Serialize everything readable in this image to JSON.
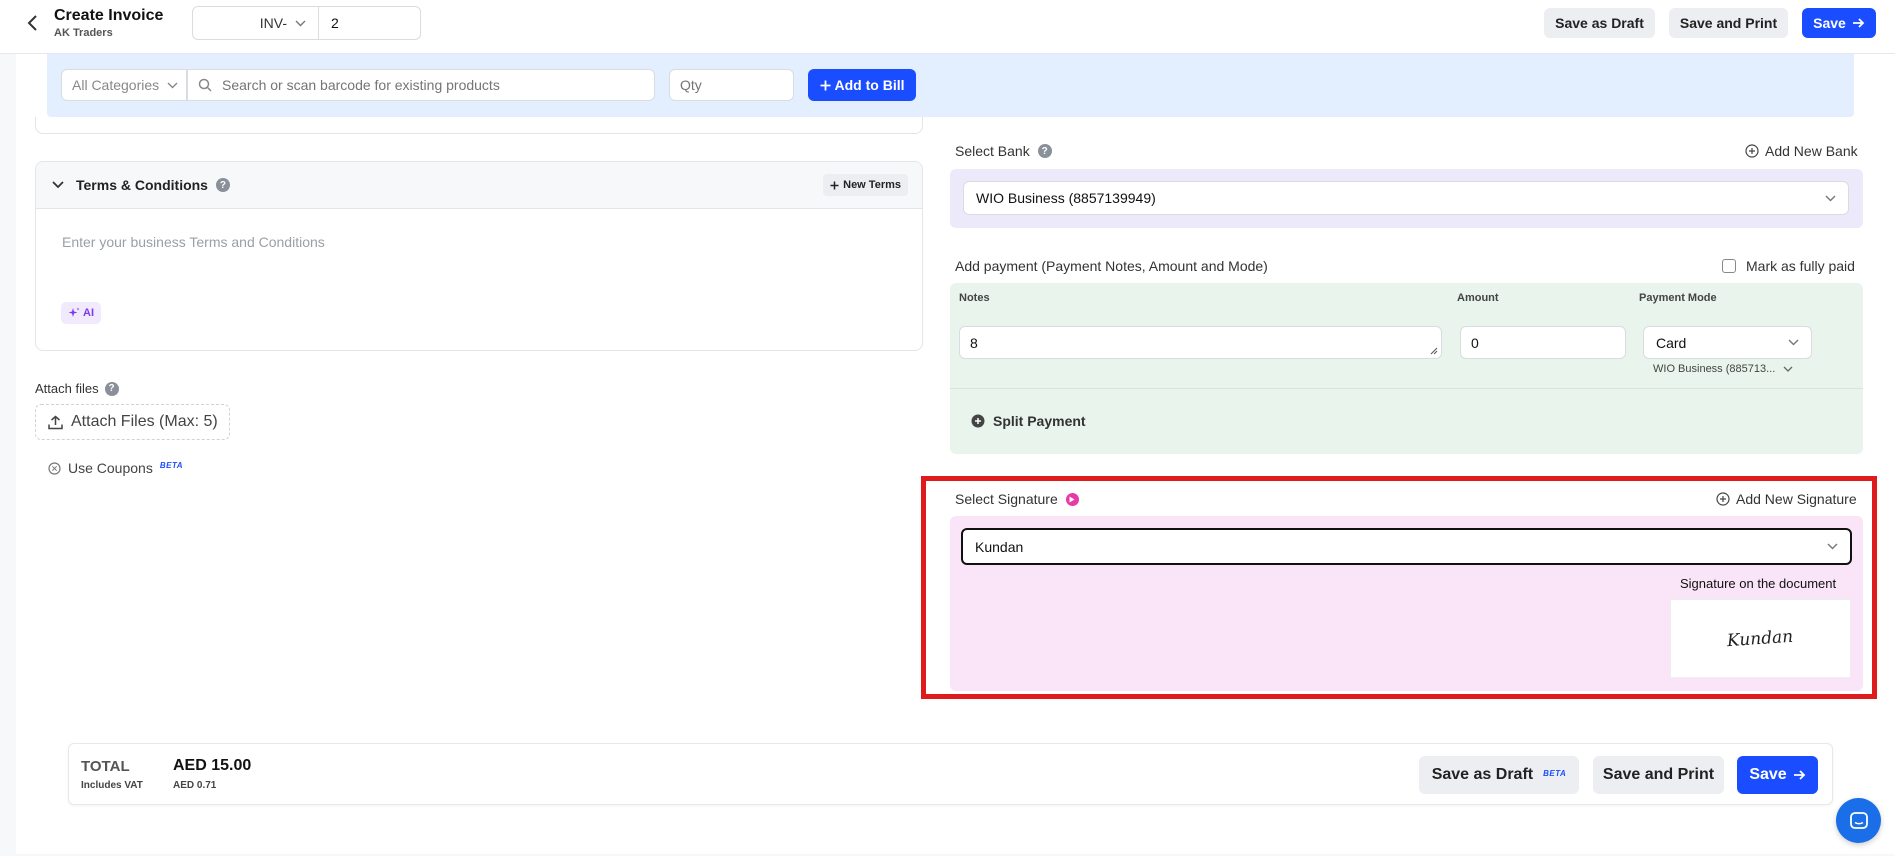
{
  "header": {
    "title": "Create Invoice",
    "subtitle": "AK Traders",
    "prefix": "INV-",
    "invoice_number": "2",
    "save_draft_label": "Save as Draft",
    "save_print_label": "Save and Print",
    "save_label": "Save"
  },
  "product_bar": {
    "category": "All Categories",
    "search_placeholder": "Search or scan barcode for existing products",
    "qty_placeholder": "Qty",
    "add_label": "Add to Bill"
  },
  "terms": {
    "title": "Terms & Conditions",
    "help": "?",
    "new_terms_label": "New Terms",
    "placeholder": "Enter your business Terms and Conditions",
    "ai_label": "AI"
  },
  "attach": {
    "label": "Attach files",
    "help": "?",
    "button_label": "Attach Files (Max: 5)"
  },
  "coupons": {
    "label": "Use Coupons",
    "beta": "BETA"
  },
  "bank": {
    "label": "Select Bank",
    "help": "?",
    "add_label": "Add New Bank",
    "selected": "WIO Business (8857139949)"
  },
  "payment": {
    "label": "Add payment (Payment Notes, Amount and Mode)",
    "fully_paid_label": "Mark as fully paid",
    "col_notes": "Notes",
    "col_amount": "Amount",
    "col_mode": "Payment Mode",
    "notes_value": "8",
    "amount_value": "0",
    "mode_value": "Card",
    "bank_short": "WIO Business (885713...",
    "split_label": "Split Payment"
  },
  "signature": {
    "label": "Select Signature",
    "add_label": "Add New Signature",
    "selected": "Kundan",
    "caption": "Signature on the document",
    "signature_text": "Kundan"
  },
  "footer": {
    "total_label": "TOTAL",
    "vat_label": "Includes VAT",
    "total_amount": "AED 15.00",
    "vat_amount": "AED 0.71",
    "save_draft_label": "Save as Draft",
    "beta": "BETA",
    "save_print_label": "Save and Print",
    "save_label": "Save"
  },
  "colors": {
    "primary": "#1a4dff",
    "highlight": "#e01b1b",
    "bank_bg": "#ece9fb",
    "payment_bg": "#e8f4ec",
    "signature_bg": "#fae4f7"
  }
}
